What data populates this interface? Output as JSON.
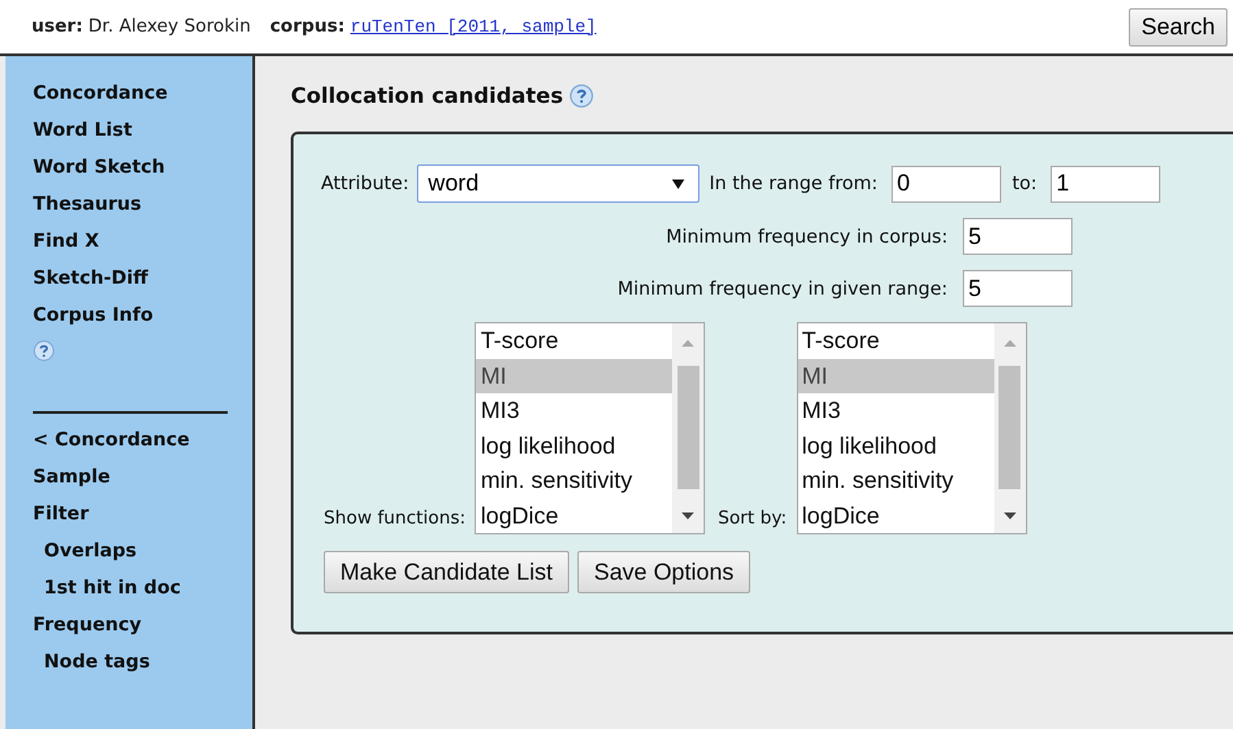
{
  "header": {
    "user_label": "user:",
    "user": "Dr. Alexey Sorokin",
    "corpus_label": "corpus:",
    "corpus": "ruTenTen [2011, sample]",
    "search_button": "Search"
  },
  "sidebar": {
    "items": [
      {
        "label": "Concordance"
      },
      {
        "label": "Word List"
      },
      {
        "label": "Word Sketch"
      },
      {
        "label": "Thesaurus"
      },
      {
        "label": "Find X"
      },
      {
        "label": "Sketch-Diff"
      },
      {
        "label": "Corpus Info"
      }
    ],
    "sub_items": [
      {
        "label": "< Concordance"
      },
      {
        "label": "Sample"
      },
      {
        "label": "Filter",
        "children": [
          {
            "label": "Overlaps"
          },
          {
            "label": "1st hit in doc"
          }
        ]
      },
      {
        "label": "Frequency",
        "children": [
          {
            "label": "Node tags"
          }
        ]
      }
    ]
  },
  "title": "Collocation candidates",
  "form": {
    "attribute_label": "Attribute:",
    "attribute": "word",
    "range_from_label": "In the range from:",
    "range_from": "0",
    "range_to_label": "to:",
    "range_to": "1",
    "min_corpus_label": "Minimum frequency in corpus:",
    "min_corpus": "5",
    "min_range_label": "Minimum frequency in given range:",
    "min_range": "5",
    "listboxes": [
      {
        "label": "Show functions:",
        "options": [
          {
            "label": "T-score",
            "selected": false
          },
          {
            "label": "MI",
            "selected": true
          },
          {
            "label": "MI3",
            "selected": false
          },
          {
            "label": "log likelihood",
            "selected": false
          },
          {
            "label": "min. sensitivity",
            "selected": false
          },
          {
            "label": "logDice",
            "selected": false
          }
        ]
      },
      {
        "label": "Sort by:",
        "options": [
          {
            "label": "T-score",
            "selected": false
          },
          {
            "label": "MI",
            "selected": true
          },
          {
            "label": "MI3",
            "selected": false
          },
          {
            "label": "log likelihood",
            "selected": false
          },
          {
            "label": "min. sensitivity",
            "selected": false
          },
          {
            "label": "logDice",
            "selected": false
          }
        ]
      }
    ],
    "buttons": [
      "Make Candidate List",
      "Save Options"
    ]
  }
}
